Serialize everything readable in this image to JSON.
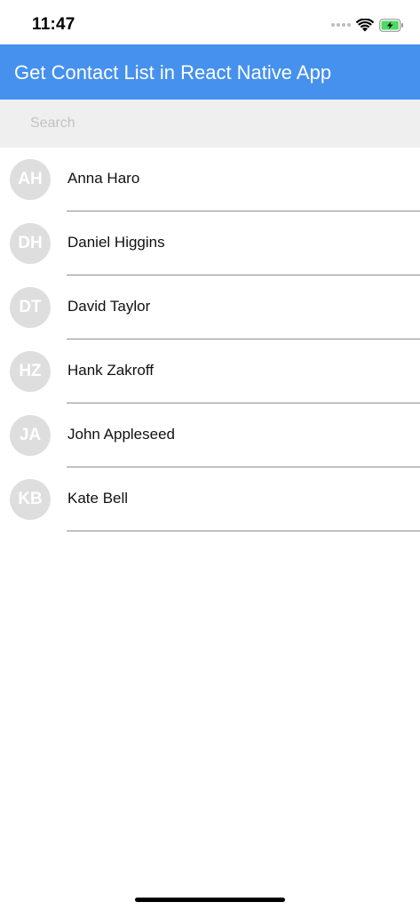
{
  "status_bar": {
    "time": "11:47",
    "icons": [
      "signal-dots-icon",
      "wifi-icon",
      "battery-charging-icon"
    ],
    "battery_color": "#4cd964"
  },
  "header": {
    "title": "Get Contact List in React Native App",
    "background": "#4591ed"
  },
  "search": {
    "placeholder": "Search",
    "value": ""
  },
  "contacts": [
    {
      "initials": "AH",
      "name": "Anna Haro"
    },
    {
      "initials": "DH",
      "name": "Daniel Higgins"
    },
    {
      "initials": "DT",
      "name": "David Taylor"
    },
    {
      "initials": "HZ",
      "name": "Hank Zakroff"
    },
    {
      "initials": "JA",
      "name": "John Appleseed"
    },
    {
      "initials": "KB",
      "name": "Kate Bell"
    }
  ]
}
